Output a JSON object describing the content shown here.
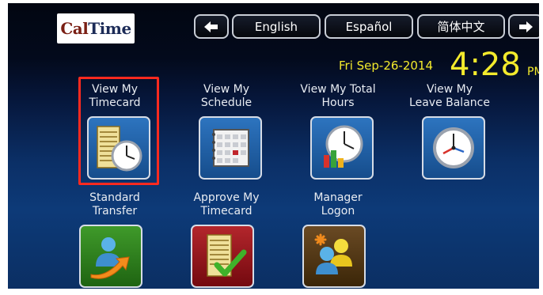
{
  "header": {
    "logo_text_prefix": "Cal",
    "logo_text_suffix": "Time",
    "back_icon": "left-arrow-icon",
    "forward_icon": "right-arrow-icon",
    "languages": [
      "English",
      "Español",
      "简体中文"
    ]
  },
  "clock": {
    "date": "Fri Sep-26-2014",
    "time": "4:28",
    "ampm": "PM"
  },
  "tiles": [
    {
      "label_line1": "View My",
      "label_line2": "Timecard",
      "icon": "timecard-clock-icon"
    },
    {
      "label_line1": "View My",
      "label_line2": "Schedule",
      "icon": "schedule-book-icon"
    },
    {
      "label_line1": "View My Total",
      "label_line2": "Hours",
      "icon": "clock-chart-icon"
    },
    {
      "label_line1": "View My",
      "label_line2": "Leave Balance",
      "icon": "clock-icon"
    },
    {
      "label_line1": "Standard",
      "label_line2": "Transfer",
      "icon": "transfer-user-icon"
    },
    {
      "label_line1": "Approve My",
      "label_line2": "Timecard",
      "icon": "approve-timecard-icon"
    },
    {
      "label_line1": "Manager",
      "label_line2": "Logon",
      "icon": "manager-users-icon"
    }
  ],
  "colors": {
    "accent_text": "#f3ea2c",
    "highlight": "#ff2a1f",
    "tile_blue": "#2d74bf",
    "tile_green": "#3f9a2a",
    "tile_red": "#b3262c",
    "tile_brown": "#6a4a24"
  }
}
